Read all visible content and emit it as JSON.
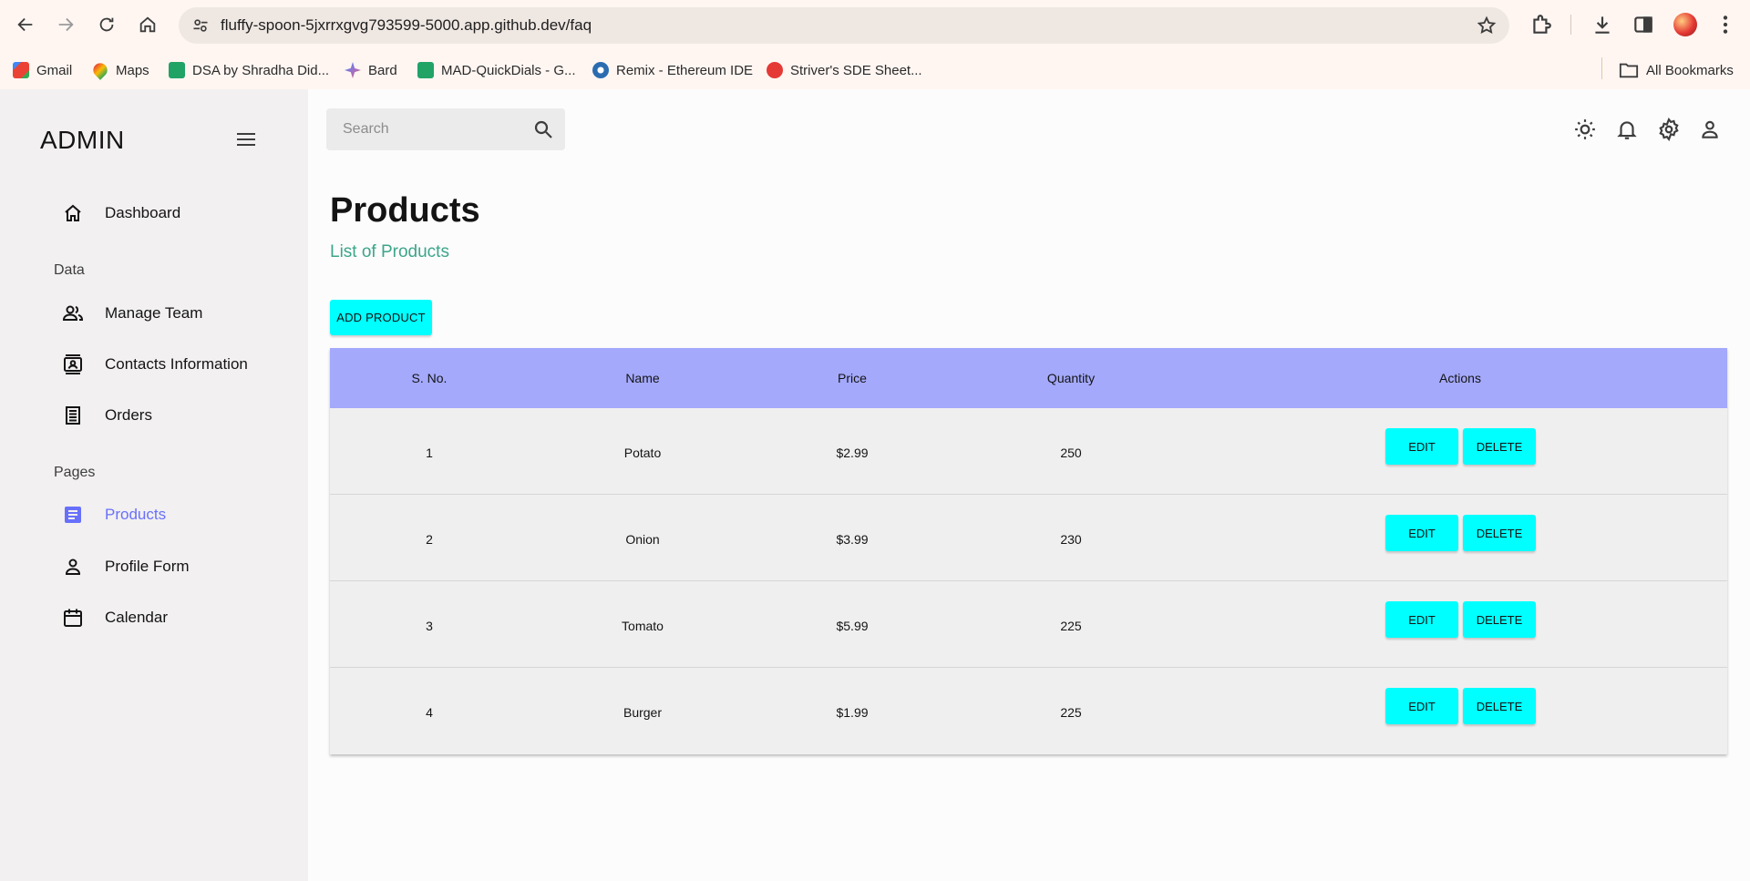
{
  "browser": {
    "url": "fluffy-spoon-5jxrrxgvg793599-5000.app.github.dev/faq",
    "bookmarks": [
      {
        "label": "Gmail",
        "color": "#ea4335"
      },
      {
        "label": "Maps",
        "color": "#34a853"
      },
      {
        "label": "DSA by Shradha Did...",
        "color": "#21a366"
      },
      {
        "label": "Bard",
        "color": "#4285f4"
      },
      {
        "label": "MAD-QuickDials - G...",
        "color": "#21a366"
      },
      {
        "label": "Remix - Ethereum IDE",
        "color": "#2b6cb0"
      },
      {
        "label": "Striver's SDE Sheet...",
        "color": "#e53935"
      }
    ],
    "all_bookmarks": "All Bookmarks"
  },
  "sidebar": {
    "brand": "ADMIN",
    "items": [
      {
        "label": "Dashboard",
        "icon": "home-icon"
      },
      {
        "label": "Manage Team",
        "icon": "people-icon"
      },
      {
        "label": "Contacts Information",
        "icon": "contacts-icon"
      },
      {
        "label": "Orders",
        "icon": "receipt-icon"
      },
      {
        "label": "Products",
        "icon": "article-icon",
        "active": true
      },
      {
        "label": "Profile Form",
        "icon": "person-icon"
      },
      {
        "label": "Calendar",
        "icon": "calendar-icon"
      }
    ],
    "sections": {
      "data": "Data",
      "pages": "Pages"
    },
    "active_color": "#6870fa"
  },
  "topbar": {
    "search_placeholder": "Search"
  },
  "page": {
    "title": "Products",
    "subtitle": "List of Products",
    "add_button": "ADD PRODUCT"
  },
  "table": {
    "headers": [
      "S. No.",
      "Name",
      "Price",
      "Quantity",
      "Actions"
    ],
    "rows": [
      {
        "sno": "1",
        "name": "Potato",
        "price": "$2.99",
        "quantity": "250"
      },
      {
        "sno": "2",
        "name": "Onion",
        "price": "$3.99",
        "quantity": "230"
      },
      {
        "sno": "3",
        "name": "Tomato",
        "price": "$5.99",
        "quantity": "225"
      },
      {
        "sno": "4",
        "name": "Burger",
        "price": "$1.99",
        "quantity": "225"
      }
    ],
    "edit_label": "EDIT",
    "delete_label": "DELETE",
    "header_color": "#a4a9fc",
    "button_color": "#00ffff"
  }
}
